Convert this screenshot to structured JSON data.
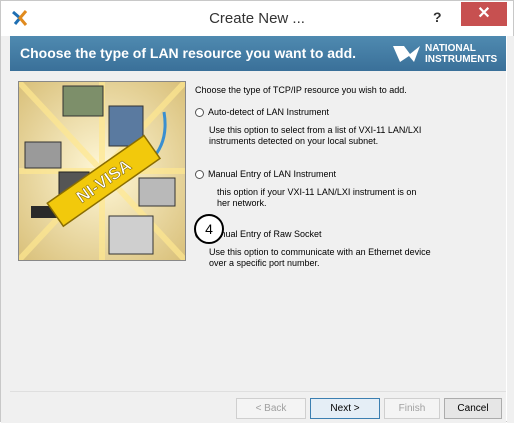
{
  "window": {
    "title": "Create New ...",
    "help_label": "?",
    "close_label": "✕"
  },
  "header": {
    "title": "Choose the type of LAN resource you want to add.",
    "logo_line1": "NATIONAL",
    "logo_line2": "INSTRUMENTS"
  },
  "image": {
    "banner_text": "NI-VISA"
  },
  "content": {
    "intro": "Choose the type of TCP/IP resource you wish to add.",
    "options": [
      {
        "label": "Auto-detect of LAN Instrument",
        "description_line1": "Use this option to select from a list of VXI-11 LAN/LXI",
        "description_line2": "instruments detected on your local subnet.",
        "checked": false
      },
      {
        "label": "Manual Entry of LAN Instrument",
        "description_line1": "this option if your VXI-11 LAN/LXI instrument is on",
        "description_line2": "her network.",
        "checked": false
      },
      {
        "label": "Manual Entry of Raw Socket",
        "description_line1": "Use this option to communicate with an Ethernet device",
        "description_line2": "over a specific port number.",
        "checked": true
      }
    ],
    "step_badge": "4"
  },
  "buttons": {
    "back": "< Back",
    "next": "Next >",
    "finish": "Finish",
    "cancel": "Cancel"
  }
}
